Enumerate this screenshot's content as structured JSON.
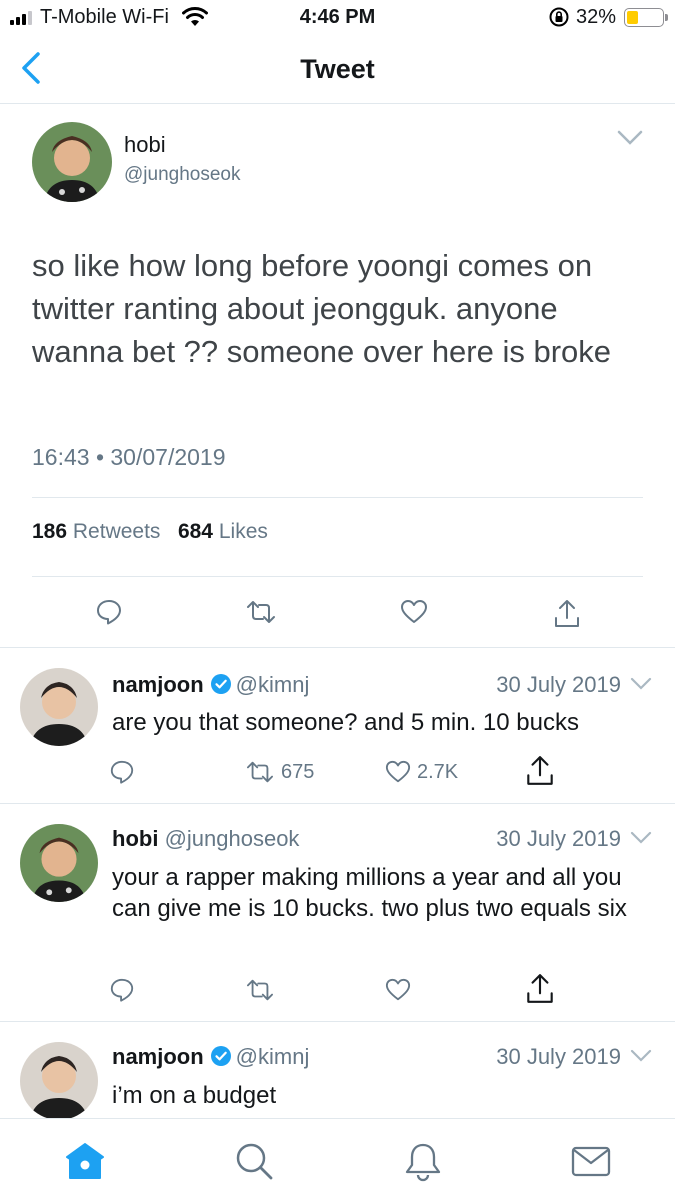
{
  "status_bar": {
    "carrier": "T-Mobile Wi-Fi",
    "time": "4:46 PM",
    "battery_percent_label": "32%",
    "battery_level": 0.32
  },
  "nav": {
    "title": "Tweet",
    "back_icon": "chevron-left-icon"
  },
  "main_tweet": {
    "name": "hobi",
    "handle": "@junghoseok",
    "text": "so like how long before yoongi comes on twitter ranting about jeongguk. anyone wanna bet ?? someone over here is broke",
    "timestamp": "16:43 • 30/07/2019",
    "retweets_count": "186",
    "retweets_label": "Retweets",
    "likes_count": "684",
    "likes_label": "Likes"
  },
  "replies": [
    {
      "name": "namjoon",
      "verified": true,
      "handle": "@kimnj",
      "date": "30 July 2019",
      "text": "are you that someone? and 5 min. 10 bucks",
      "retweets": "675",
      "likes": "2.7K"
    },
    {
      "name": "hobi",
      "verified": false,
      "handle": "@junghoseok",
      "date": "30 July 2019",
      "text": "your a rapper making millions a year and all you can give me is 10 bucks. two plus two equals six",
      "retweets": "",
      "likes": ""
    },
    {
      "name": "namjoon",
      "verified": true,
      "handle": "@kimnj",
      "date": "30 July 2019",
      "text": "i’m on a budget"
    }
  ],
  "tab_bar": [
    "home-icon",
    "search-icon",
    "notifications-icon",
    "messages-icon"
  ],
  "colors": {
    "accent": "#1da1f2",
    "secondary_text": "#657786",
    "divider": "#e1e8ed",
    "battery": "#ffcc00"
  }
}
